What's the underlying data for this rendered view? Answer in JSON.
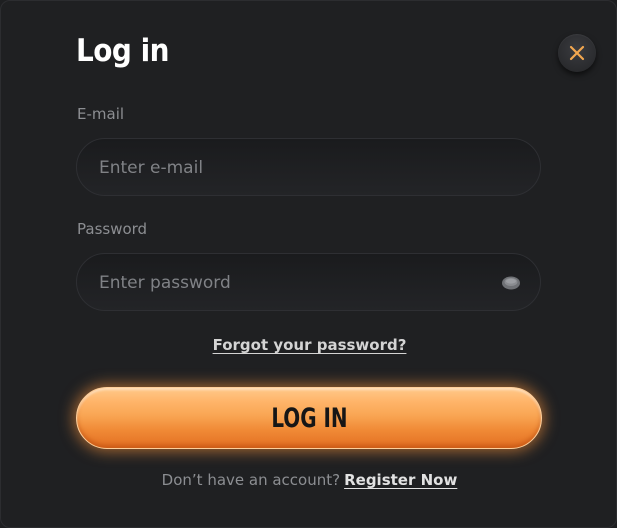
{
  "title": "Log in",
  "email": {
    "label": "E-mail",
    "placeholder": "Enter e-mail",
    "value": ""
  },
  "password": {
    "label": "Password",
    "placeholder": "Enter password",
    "value": ""
  },
  "forgot_link": "Forgot your password?",
  "login_button": "LOG IN",
  "register": {
    "prompt": "Don’t have an account?",
    "link": "Register Now"
  },
  "icons": {
    "close": "close-icon",
    "eye": "eye-icon"
  },
  "colors": {
    "background": "#1f2022",
    "accent": "#f5a04c",
    "close_x": "#f2a74f"
  }
}
